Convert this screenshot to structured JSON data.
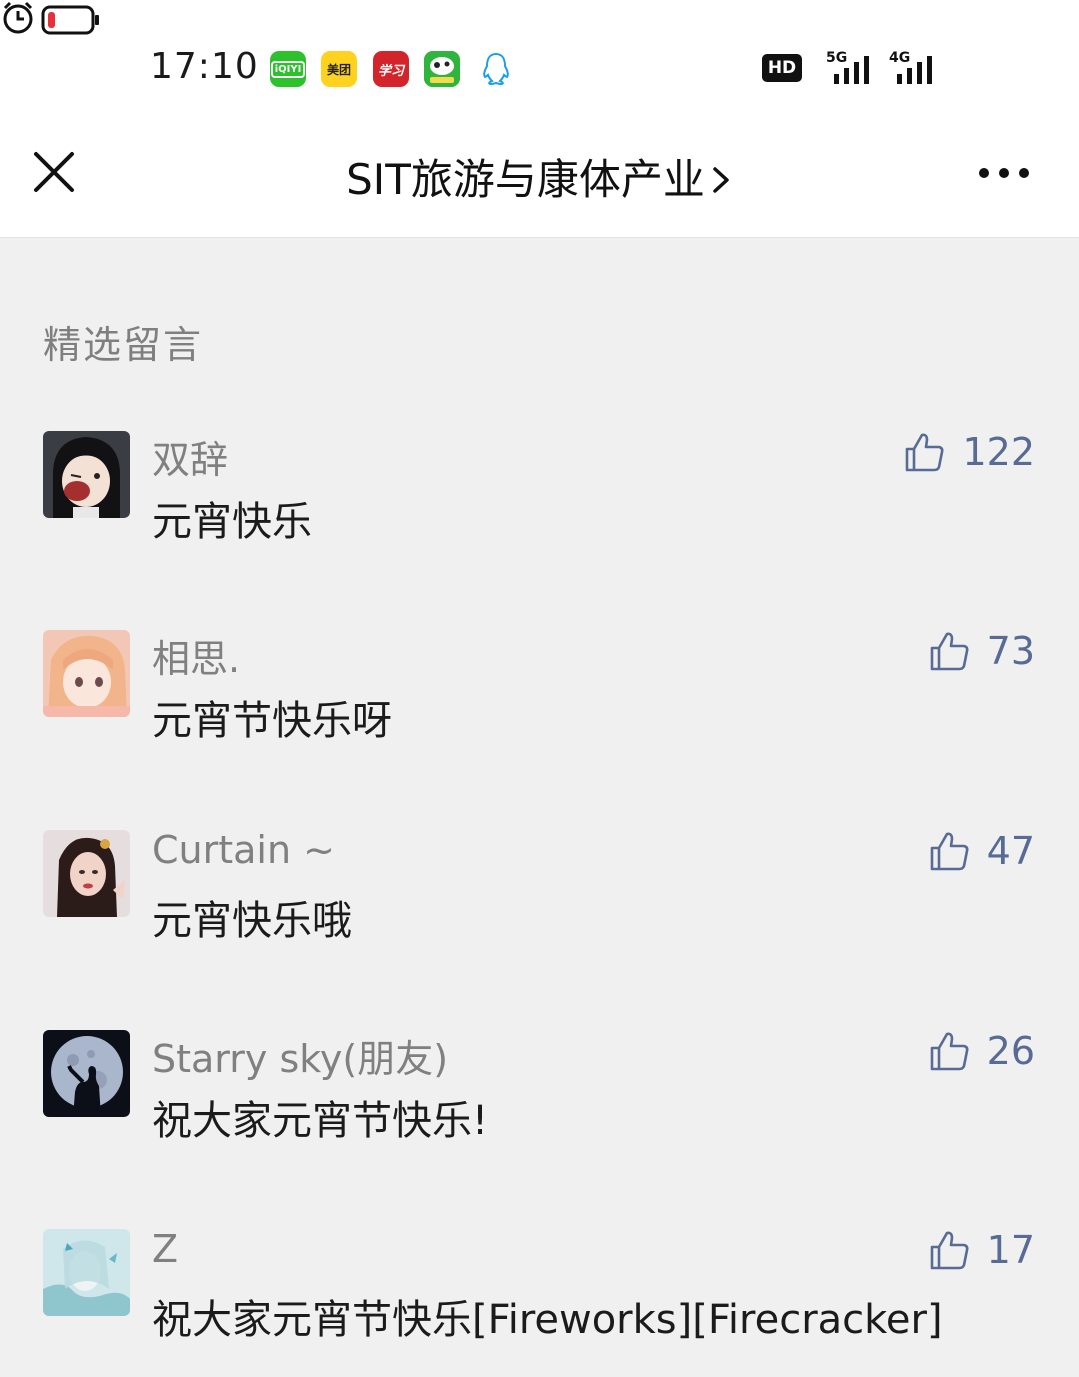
{
  "status_bar": {
    "time": "17:10",
    "app_icons": [
      "iqiyi-icon",
      "meituan-icon",
      "xuexi-icon",
      "game-icon",
      "qq-icon"
    ],
    "app_labels": {
      "iqiyi": "iQIYI",
      "meituan": "美团",
      "xuexi": "学习"
    },
    "indicators": [
      "alarm-icon",
      "hd-icon",
      "signal-5g-icon",
      "signal-4g-icon",
      "battery-icon"
    ],
    "hd_label": "HD",
    "net1": "5G",
    "net2": "4G",
    "battery_color": "#e8303a"
  },
  "header": {
    "title": "SIT旅游与康体产业"
  },
  "section": {
    "title": "精选留言"
  },
  "comments": [
    {
      "nickname": "双辞",
      "content": "元宵快乐",
      "likes": "122"
    },
    {
      "nickname": "相思.",
      "content": "元宵节快乐呀",
      "likes": "73"
    },
    {
      "nickname": "Curtain ~",
      "content": "元宵快乐哦",
      "likes": "47"
    },
    {
      "nickname": "Starry sky(朋友)",
      "content": "祝大家元宵节快乐!",
      "likes": "26"
    },
    {
      "nickname": "Z",
      "content": "祝大家元宵节快乐[Fireworks][Firecracker]",
      "likes": "17"
    }
  ],
  "colors": {
    "link_blue": "#576b95",
    "nickname_gray": "#808080",
    "background": "#f0f0f0"
  }
}
